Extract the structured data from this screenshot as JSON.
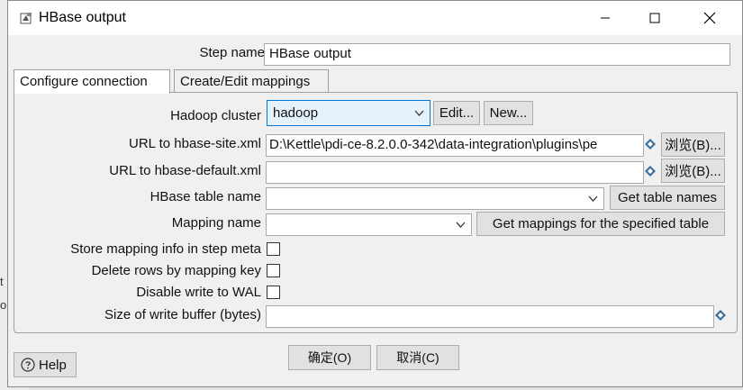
{
  "window": {
    "title": "HBase output"
  },
  "step": {
    "label": "Step name",
    "value": "HBase output"
  },
  "tabs": [
    {
      "label": "Configure connection"
    },
    {
      "label": "Create/Edit mappings"
    }
  ],
  "form": {
    "hadoop_cluster": {
      "label": "Hadoop cluster",
      "value": "hadoop",
      "edit": "Edit...",
      "new": "New..."
    },
    "hbase_site": {
      "label": "URL to hbase-site.xml",
      "value": "D:\\Kettle\\pdi-ce-8.2.0.0-342\\data-integration\\plugins\\pe",
      "browse": "浏览(B)..."
    },
    "hbase_default": {
      "label": "URL to hbase-default.xml",
      "value": "",
      "browse": "浏览(B)..."
    },
    "table_name": {
      "label": "HBase table name",
      "value": "",
      "button": "Get table names"
    },
    "mapping_name": {
      "label": "Mapping name",
      "value": "",
      "button": "Get mappings for the specified table"
    },
    "store_mapping": {
      "label": "Store mapping info in step meta",
      "checked": false
    },
    "delete_rows": {
      "label": "Delete rows by mapping key",
      "checked": false
    },
    "disable_wal": {
      "label": "Disable write to WAL",
      "checked": false
    },
    "write_buffer": {
      "label": "Size of write buffer (bytes)",
      "value": ""
    }
  },
  "footer": {
    "help": "Help",
    "ok": "确定(O)",
    "cancel": "取消(C)"
  },
  "background": {
    "fragment_1": "t",
    "fragment_2": "ou"
  },
  "colors": {
    "accent": "#0078d7",
    "variable_icon": "#3a6e9e"
  }
}
